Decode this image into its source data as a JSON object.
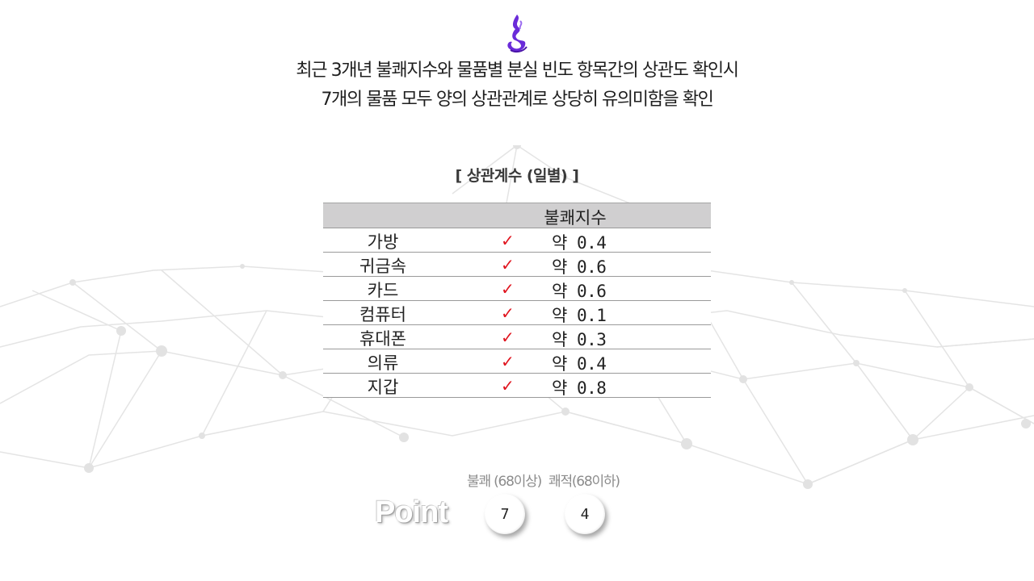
{
  "headline": {
    "line1": "최근 3개년 불쾌지수와 물품별 분실 빈도 항목간의 상관도 확인시",
    "line2": "7개의 물품 모두 양의 상관관계로 상당히 유의미함을 확인"
  },
  "table": {
    "title": "[ 상관계수 (일별) ]",
    "header": "불쾌지수",
    "check_glyph": "✓",
    "rows": [
      {
        "item": "가방",
        "value": "약 0.4"
      },
      {
        "item": "귀금속",
        "value": "약 0.6"
      },
      {
        "item": "카드",
        "value": "약 0.6"
      },
      {
        "item": "컴퓨터",
        "value": "약 0.1"
      },
      {
        "item": "휴대폰",
        "value": "약 0.3"
      },
      {
        "item": "의류",
        "value": "약 0.4"
      },
      {
        "item": "지갑",
        "value": "약 0.8"
      }
    ]
  },
  "point": {
    "label": "Point",
    "caption_1": "불쾌 (68이상)",
    "caption_2": "쾌적(68이하)",
    "value_1": "7",
    "value_2": "4"
  },
  "colors": {
    "check": "#e0141e",
    "header_bg": "#d0cfd0",
    "logo": "#6a2bd9"
  },
  "icons": {
    "logo": "purple-flame-icon",
    "background": "network-lines-graphic",
    "check": "checkmark-icon"
  }
}
